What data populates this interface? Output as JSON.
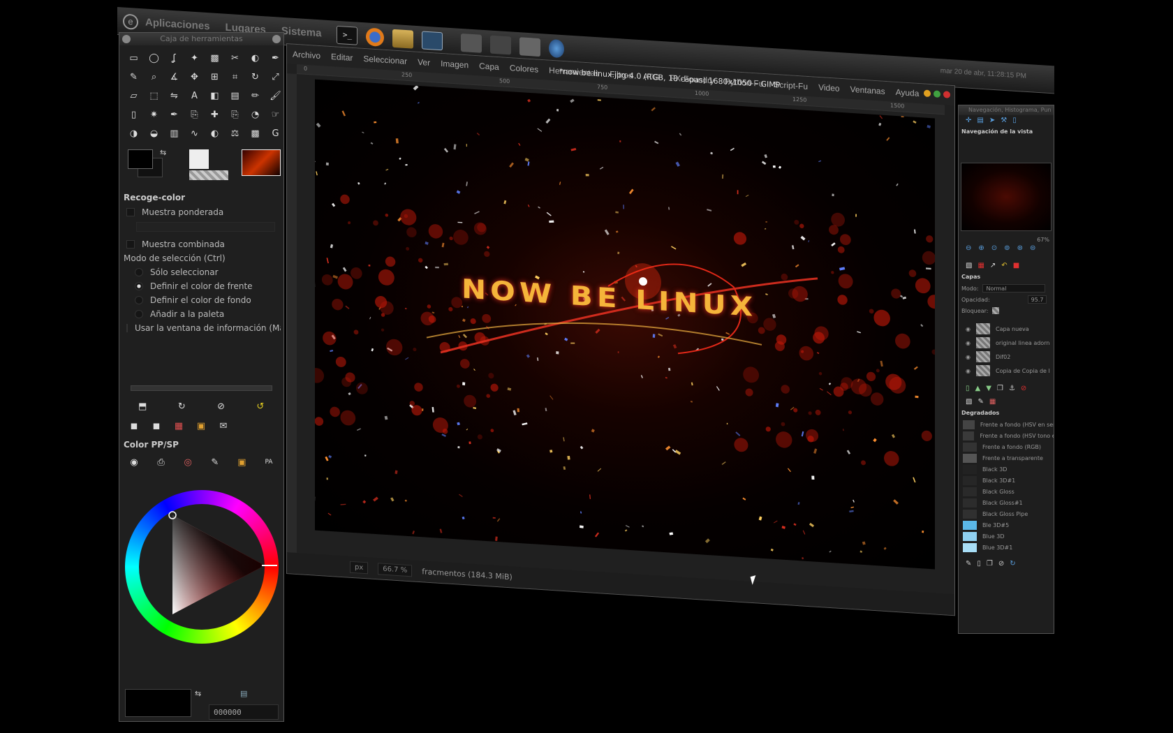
{
  "panel": {
    "menus": [
      "Aplicaciones",
      "Lugares",
      "Sistema"
    ],
    "clock": "mar 20 de abr, 11:28:15 PM"
  },
  "toolbox": {
    "title": "Caja de herramientas",
    "tool_icons": [
      "rect-select",
      "ellipse-select",
      "lasso",
      "fuzzy-select",
      "color-select",
      "scissors",
      "foreground-select",
      "paths",
      "color-picker",
      "zoom",
      "measure",
      "move",
      "align",
      "crop",
      "rotate",
      "scale",
      "shear",
      "perspective",
      "flip",
      "text",
      "bucket-fill",
      "blend",
      "pencil",
      "paintbrush",
      "eraser",
      "airbrush",
      "ink",
      "clone",
      "heal",
      "perspective-clone",
      "blur",
      "smudge",
      "dodge",
      "burn",
      "levels",
      "curves",
      "threshold",
      "color-balance",
      "desaturate",
      "gegl"
    ],
    "tool_options_title": "Recoge-color",
    "sample_merged": "Muestra ponderada",
    "sample_average": "Muestra combinada",
    "mode_label": "Modo de selección  (Ctrl)",
    "mode_options": [
      "Sólo seleccionar",
      "Definir el color de frente",
      "Definir el color de fondo",
      "Añadir a la paleta"
    ],
    "selected_mode_index": 1,
    "info_window": "Usar la ventana de información  (Mayús",
    "color_dialog_title": "Color PP/SP",
    "hex_value": "000000"
  },
  "image_window": {
    "title": "*now be linux.jpg-4.0 (RGB, 18 capas) 1680x1050 – GIMP",
    "menu": [
      "Archivo",
      "Editar",
      "Seleccionar",
      "Ver",
      "Imagen",
      "Capa",
      "Colores",
      "Herramientas",
      "Filtros",
      "ATG",
      "FX-Foundry",
      "Python-Fu",
      "Script-Fu",
      "Video",
      "Ventanas",
      "Ayuda"
    ],
    "ruler_marks": [
      "0",
      "250",
      "500",
      "750",
      "1000",
      "1250",
      "1500"
    ],
    "unit": "px",
    "zoom": "66.7 %",
    "status": "fracmentos (184.3 MiB)",
    "canvas_text": "NOW BE LINUX",
    "colors": {
      "red": "#e0201a",
      "gold": "#f5b43a"
    }
  },
  "dock": {
    "title": "Navegación, Histograma, Pun",
    "nav_title": "Navegación de la vista",
    "zoom_pct": "67%",
    "layers_title": "Capas",
    "mode_label": "Modo:",
    "mode_value": "Normal",
    "opacity_label": "Opacidad:",
    "opacity_value": "95.7",
    "lock_label": "Bloquear:",
    "layers": [
      "Capa nueva",
      "original linea adorn",
      "Dif02",
      "Copia de Copia de l"
    ],
    "gradients_title": "Degradados",
    "gradients": [
      {
        "name": "Frente a fondo (HSV en sentido",
        "color": "#444"
      },
      {
        "name": "Frente a fondo (HSV tono en ser",
        "color": "#3a3a3a"
      },
      {
        "name": "Frente a fondo (RGB)",
        "color": "#333"
      },
      {
        "name": "Frente a transparente",
        "color": "#555"
      },
      {
        "name": "Black 3D",
        "color": "#222"
      },
      {
        "name": "Black 3D#1",
        "color": "#262626"
      },
      {
        "name": "Black Gloss",
        "color": "#2a2a2a"
      },
      {
        "name": "Black Gloss#1",
        "color": "#2c2c2c"
      },
      {
        "name": "Black Gloss Pipe",
        "color": "#303030"
      },
      {
        "name": "Ble 3D#5",
        "color": "#5bb8e8"
      },
      {
        "name": "Blue 3D",
        "color": "#8fd0f0"
      },
      {
        "name": "Blue 3D#1",
        "color": "#a8def6"
      }
    ]
  }
}
